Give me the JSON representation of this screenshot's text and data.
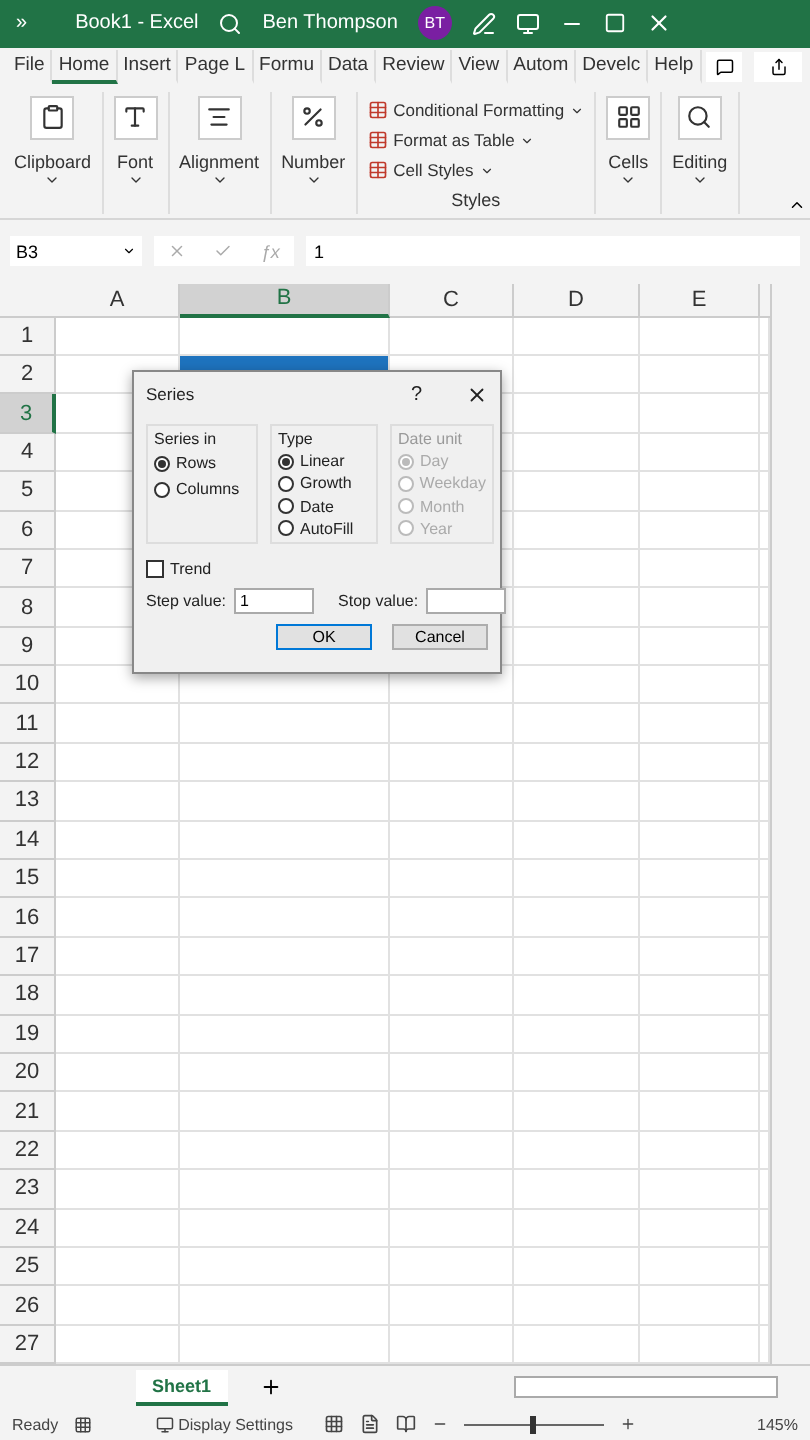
{
  "title_bar": {
    "overflow": "»",
    "title": "Book1  -  Excel",
    "user": "Ben Thompson",
    "initials": "BT"
  },
  "tabs": [
    {
      "label": "File",
      "selected": false
    },
    {
      "label": "Home",
      "selected": true
    },
    {
      "label": "Insert",
      "selected": false
    },
    {
      "label": "Page L",
      "selected": false
    },
    {
      "label": "Formu",
      "selected": false
    },
    {
      "label": "Data",
      "selected": false
    },
    {
      "label": "Review",
      "selected": false
    },
    {
      "label": "View",
      "selected": false
    },
    {
      "label": "Autom",
      "selected": false
    },
    {
      "label": "Develc",
      "selected": false
    },
    {
      "label": "Help",
      "selected": false
    }
  ],
  "ribbon": {
    "groups": [
      {
        "kind": "big",
        "label": "Clipboard"
      },
      {
        "kind": "big",
        "label": "Font"
      },
      {
        "kind": "big",
        "label": "Alignment"
      },
      {
        "kind": "big",
        "label": "Number"
      },
      {
        "kind": "styles",
        "label": "Styles",
        "items": [
          "Conditional Formatting",
          "Format as Table",
          "Cell Styles"
        ]
      },
      {
        "kind": "big",
        "label": "Cells"
      },
      {
        "kind": "big",
        "label": "Editing"
      }
    ]
  },
  "formula_bar": {
    "name_box": "B3",
    "fx": "ƒx",
    "formula": "1"
  },
  "columns": [
    {
      "label": "A",
      "selected": false
    },
    {
      "label": "B",
      "selected": true
    },
    {
      "label": "C",
      "selected": false
    },
    {
      "label": "D",
      "selected": false
    },
    {
      "label": "E",
      "selected": false
    }
  ],
  "rows": [
    {
      "label": "1",
      "selected": false,
      "filled": false
    },
    {
      "label": "2",
      "selected": false,
      "filled": true
    },
    {
      "label": "3",
      "selected": true,
      "filled": false
    },
    {
      "label": "4",
      "selected": false,
      "filled": false
    },
    {
      "label": "5",
      "selected": false,
      "filled": false
    },
    {
      "label": "6",
      "selected": false,
      "filled": false
    },
    {
      "label": "7",
      "selected": false,
      "filled": false
    },
    {
      "label": "8",
      "selected": false,
      "filled": false
    },
    {
      "label": "9",
      "selected": false,
      "filled": false
    },
    {
      "label": "10",
      "selected": false,
      "filled": false
    },
    {
      "label": "11",
      "selected": false,
      "filled": false
    },
    {
      "label": "12",
      "selected": false,
      "filled": false
    },
    {
      "label": "13",
      "selected": false,
      "filled": false
    },
    {
      "label": "14",
      "selected": false,
      "filled": false
    },
    {
      "label": "15",
      "selected": false,
      "filled": false
    },
    {
      "label": "16",
      "selected": false,
      "filled": false
    },
    {
      "label": "17",
      "selected": false,
      "filled": false
    },
    {
      "label": "18",
      "selected": false,
      "filled": false
    },
    {
      "label": "19",
      "selected": false,
      "filled": false
    },
    {
      "label": "20",
      "selected": false,
      "filled": false
    },
    {
      "label": "21",
      "selected": false,
      "filled": false
    },
    {
      "label": "22",
      "selected": false,
      "filled": false
    },
    {
      "label": "23",
      "selected": false,
      "filled": false
    },
    {
      "label": "24",
      "selected": false,
      "filled": false
    },
    {
      "label": "25",
      "selected": false,
      "filled": false
    },
    {
      "label": "26",
      "selected": false,
      "filled": false
    },
    {
      "label": "27",
      "selected": false,
      "filled": false
    }
  ],
  "dialog": {
    "title": "Series",
    "help": "?",
    "groups": [
      {
        "label": "Series in",
        "disabled": false,
        "options": [
          {
            "label": "Rows",
            "selected": true
          },
          {
            "label": "Columns",
            "selected": false
          }
        ]
      },
      {
        "label": "Type",
        "disabled": false,
        "options": [
          {
            "label": "Linear",
            "selected": true
          },
          {
            "label": "Growth",
            "selected": false
          },
          {
            "label": "Date",
            "selected": false
          },
          {
            "label": "AutoFill",
            "selected": false
          }
        ]
      },
      {
        "label": "Date unit",
        "disabled": true,
        "options": [
          {
            "label": "Day",
            "selected": true
          },
          {
            "label": "Weekday",
            "selected": false
          },
          {
            "label": "Month",
            "selected": false
          },
          {
            "label": "Year",
            "selected": false
          }
        ]
      }
    ],
    "trend": {
      "label": "Trend",
      "checked": false
    },
    "step": {
      "label": "Step value:",
      "value": "1"
    },
    "stop": {
      "label": "Stop value:"
    },
    "buttons": [
      "OK",
      "Cancel"
    ]
  },
  "sheet_tabs": [
    {
      "label": "Sheet1",
      "selected": true
    }
  ],
  "status_bar": {
    "status": "Ready",
    "display_settings": "Display Settings",
    "zoom": {
      "level": 0.47,
      "reading": "145%"
    }
  }
}
